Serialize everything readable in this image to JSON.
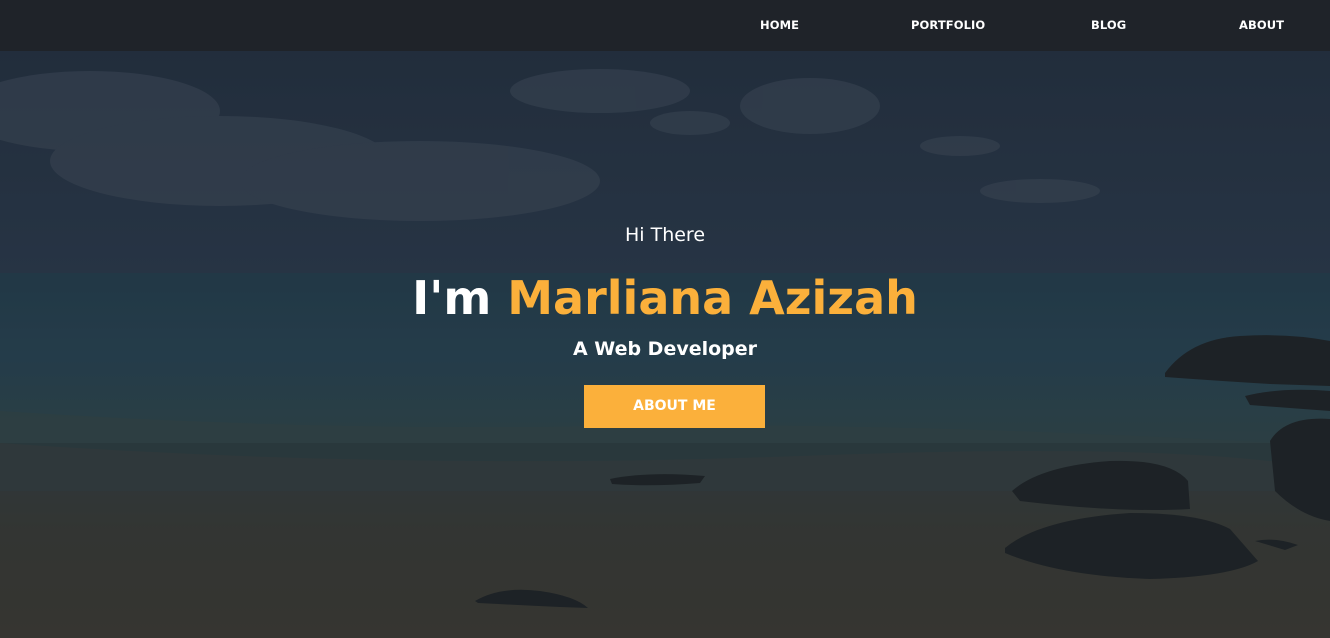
{
  "nav": {
    "items": [
      {
        "label": "HOME"
      },
      {
        "label": "PORTFOLIO"
      },
      {
        "label": "BLOG"
      },
      {
        "label": "ABOUT"
      }
    ]
  },
  "hero": {
    "greeting": "Hi There",
    "headline_prefix": "I'm",
    "headline_name": "Marliana Azizah",
    "role": "A Web Developer",
    "cta_label": "ABOUT ME"
  },
  "colors": {
    "accent": "#fbb03b",
    "navbar_bg": "#1f2329",
    "text": "#ffffff"
  }
}
